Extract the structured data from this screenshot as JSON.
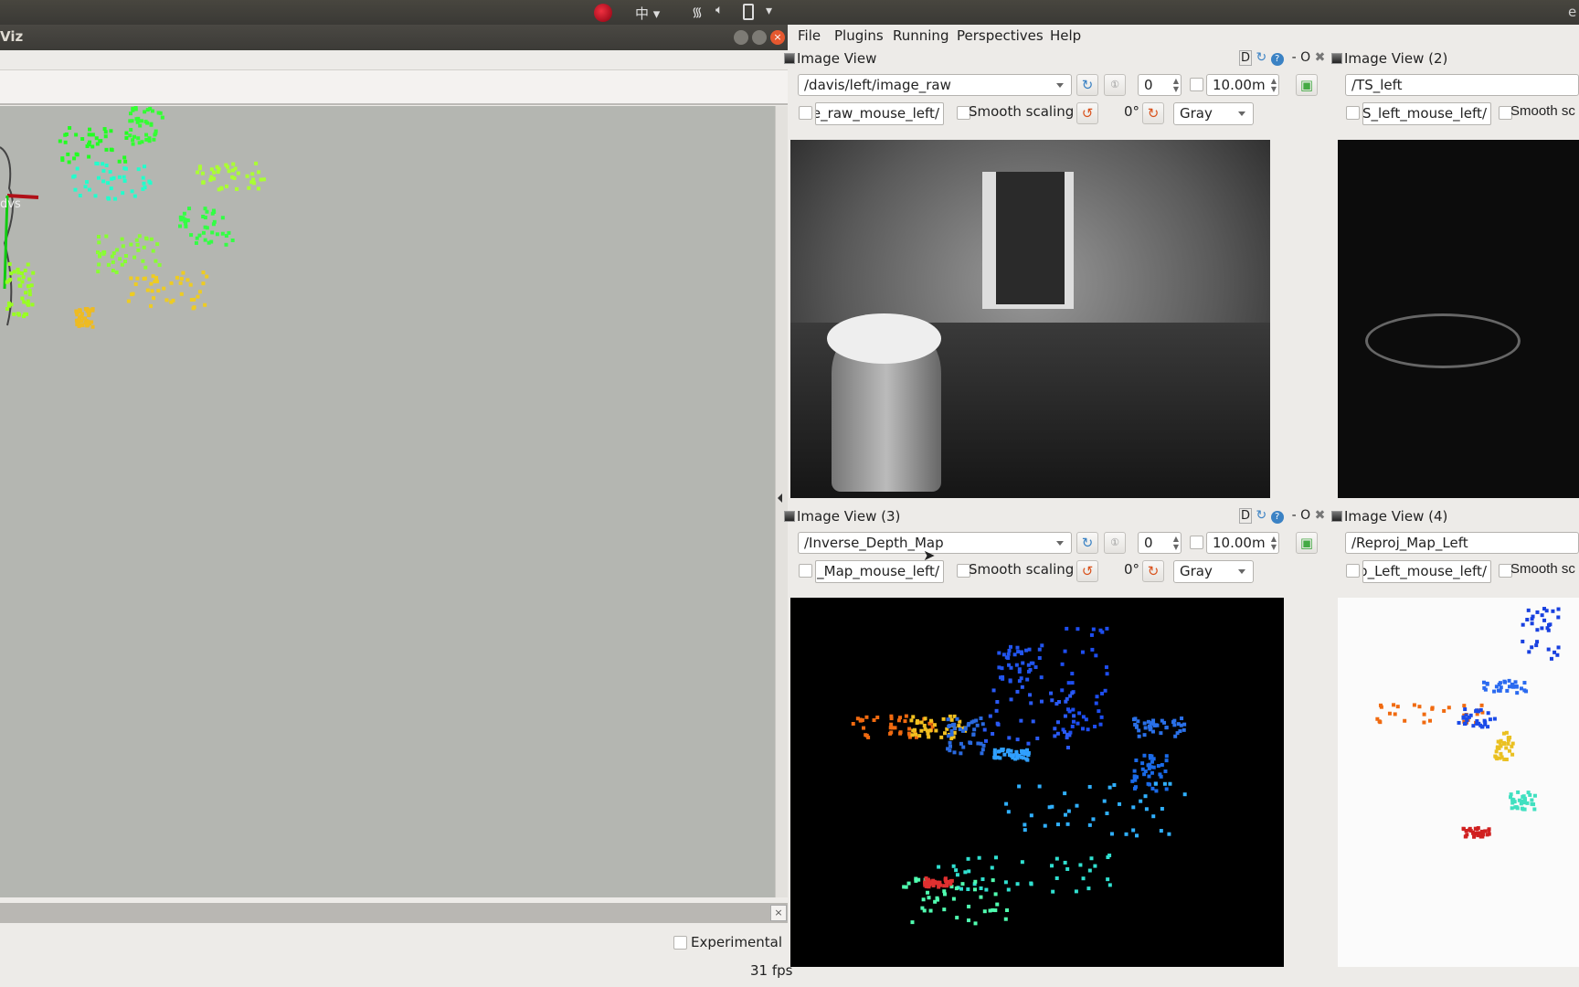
{
  "system_tray": {
    "input_method": "中",
    "icons": [
      "record-indicator-icon",
      "wifi-icon",
      "volume-icon",
      "battery-icon",
      "menu-arrow-icon"
    ],
    "right_edge_text": "e"
  },
  "rviz": {
    "title": "Viz",
    "axis_label": "dvs",
    "experimental_label": "Experimental",
    "fps": "31 fps",
    "close_glyph": "×"
  },
  "menu": [
    "File",
    "Plugins",
    "Running",
    "Perspectives",
    "Help"
  ],
  "views": [
    {
      "title": "Image View",
      "topic": "/davis/left/image_raw",
      "mouse_topic": "/davis/left/image_raw_mouse_left",
      "num": "0",
      "range": "10.00m",
      "smooth": "Smooth scaling",
      "rotation": "0°",
      "colormap": "Gray"
    },
    {
      "title": "Image View (2)",
      "topic": "/TS_left",
      "mouse_topic": "/TS_left_mouse_left",
      "smooth": "Smooth sc"
    },
    {
      "title": "Image View (3)",
      "topic": "/Inverse_Depth_Map",
      "mouse_topic": "/Inverse_Depth_Map_mouse_left",
      "num": "0",
      "range": "10.00m",
      "smooth": "Smooth scaling",
      "rotation": "0°",
      "colormap": "Gray"
    },
    {
      "title": "Image View (4)",
      "topic": "/Reproj_Map_Left",
      "mouse_topic": "/Reproj_Map_Left_mouse_left",
      "smooth": "Smooth sc"
    }
  ],
  "dock_buttons": {
    "d": "D",
    "minimize": "-",
    "float": "O",
    "close": "✖"
  },
  "colors": {
    "accent_red": "#c0151f",
    "refresh_blue": "#3b82c4",
    "rotate_orange": "#d9531e"
  }
}
